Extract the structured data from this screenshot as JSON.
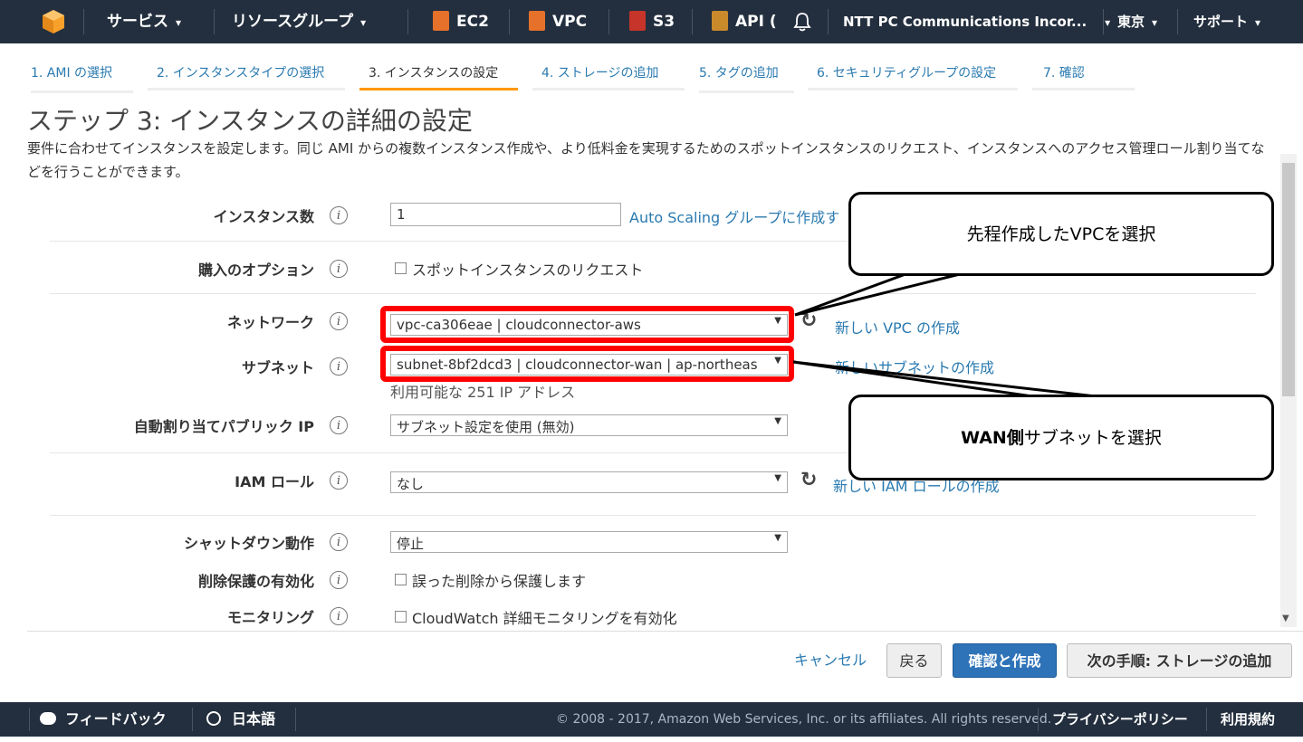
{
  "nav": {
    "services": "サービス",
    "resource_groups": "リソースグループ",
    "ec2": "EC2",
    "vpc": "VPC",
    "s3": "S3",
    "api": "API (",
    "account": "NTT PC Communications Incor...",
    "region": "東京",
    "support": "サポート",
    "caret": "▾"
  },
  "steps": [
    "1. AMI の選択",
    "2. インスタンスタイプの選択",
    "3. インスタンスの設定",
    "4. ストレージの追加",
    "5. タグの追加",
    "6. セキュリティグループの設定",
    "7. 確認"
  ],
  "page": {
    "title": "ステップ 3: インスタンスの詳細の設定",
    "description": "要件に合わせてインスタンスを設定します。同じ AMI からの複数インスタンス作成や、より低料金を実現するためのスポットインスタンスのリクエスト、インスタンスへのアクセス管理ロール割り当てなどを行うことができます。"
  },
  "form": {
    "instance_count": {
      "label": "インスタンス数",
      "value": "1",
      "link": "Auto Scaling グループに作成す"
    },
    "purchase": {
      "label": "購入のオプション",
      "checkbox": "スポットインスタンスのリクエスト"
    },
    "network": {
      "label": "ネットワーク",
      "value": "vpc-ca306eae | cloudconnector-aws",
      "link": "新しい VPC の作成"
    },
    "subnet": {
      "label": "サブネット",
      "value": "subnet-8bf2dcd3 | cloudconnector-wan | ap-northeas",
      "link": "新しいサブネットの作成",
      "hint": "利用可能な 251 IP アドレス"
    },
    "public_ip": {
      "label": "自動割り当てパブリック IP",
      "value": "サブネット設定を使用 (無効)"
    },
    "iam": {
      "label": "IAM ロール",
      "value": "なし",
      "link": "新しい IAM ロールの作成"
    },
    "shutdown": {
      "label": "シャットダウン動作",
      "value": "停止"
    },
    "termination": {
      "label": "削除保護の有効化",
      "checkbox": "誤った削除から保護します"
    },
    "monitoring": {
      "label": "モニタリング",
      "checkbox": "CloudWatch 詳細モニタリングを有効化"
    },
    "info_glyph": "i",
    "refresh_glyph": "↻"
  },
  "callouts": {
    "vpc": "先程作成したVPCを選択",
    "wan_bold": "WAN側",
    "wan_rest": "サブネットを選択"
  },
  "buttons": {
    "cancel": "キャンセル",
    "back": "戻る",
    "review_launch": "確認と作成",
    "next": "次の手順: ストレージの追加"
  },
  "footer": {
    "feedback": "フィードバック",
    "language": "日本語",
    "copyright": "© 2008 - 2017, Amazon Web Services, Inc. or its affiliates. All rights reserved.",
    "privacy": "プライバシーポリシー",
    "terms": "利用規約"
  },
  "colors": {
    "nav_bg": "#232f3e",
    "link": "#2a7ab0",
    "active_step": "#ff9900",
    "primary_button": "#2e73b8",
    "highlight": "#ff0000"
  }
}
